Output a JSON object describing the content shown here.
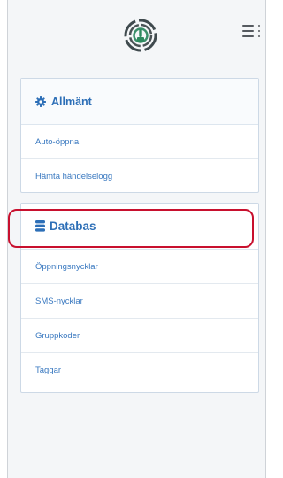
{
  "app": {
    "logo_icon": "fingerprint-logo-icon",
    "menu_icon": "menu-list-icon"
  },
  "sections": {
    "general": {
      "icon": "gear-icon",
      "title": "Allmänt",
      "items": [
        "Auto-öppna",
        "Hämta händelselogg"
      ]
    },
    "database": {
      "icon": "database-icon",
      "title": "Databas",
      "items": [
        "Öppningsnycklar",
        "SMS-nycklar",
        "Gruppkoder",
        "Taggar"
      ]
    }
  },
  "colors": {
    "accent": "#2d6fb7",
    "link": "#3a79c0",
    "highlight_ring": "#c8102e",
    "background": "#f4f6f8"
  }
}
